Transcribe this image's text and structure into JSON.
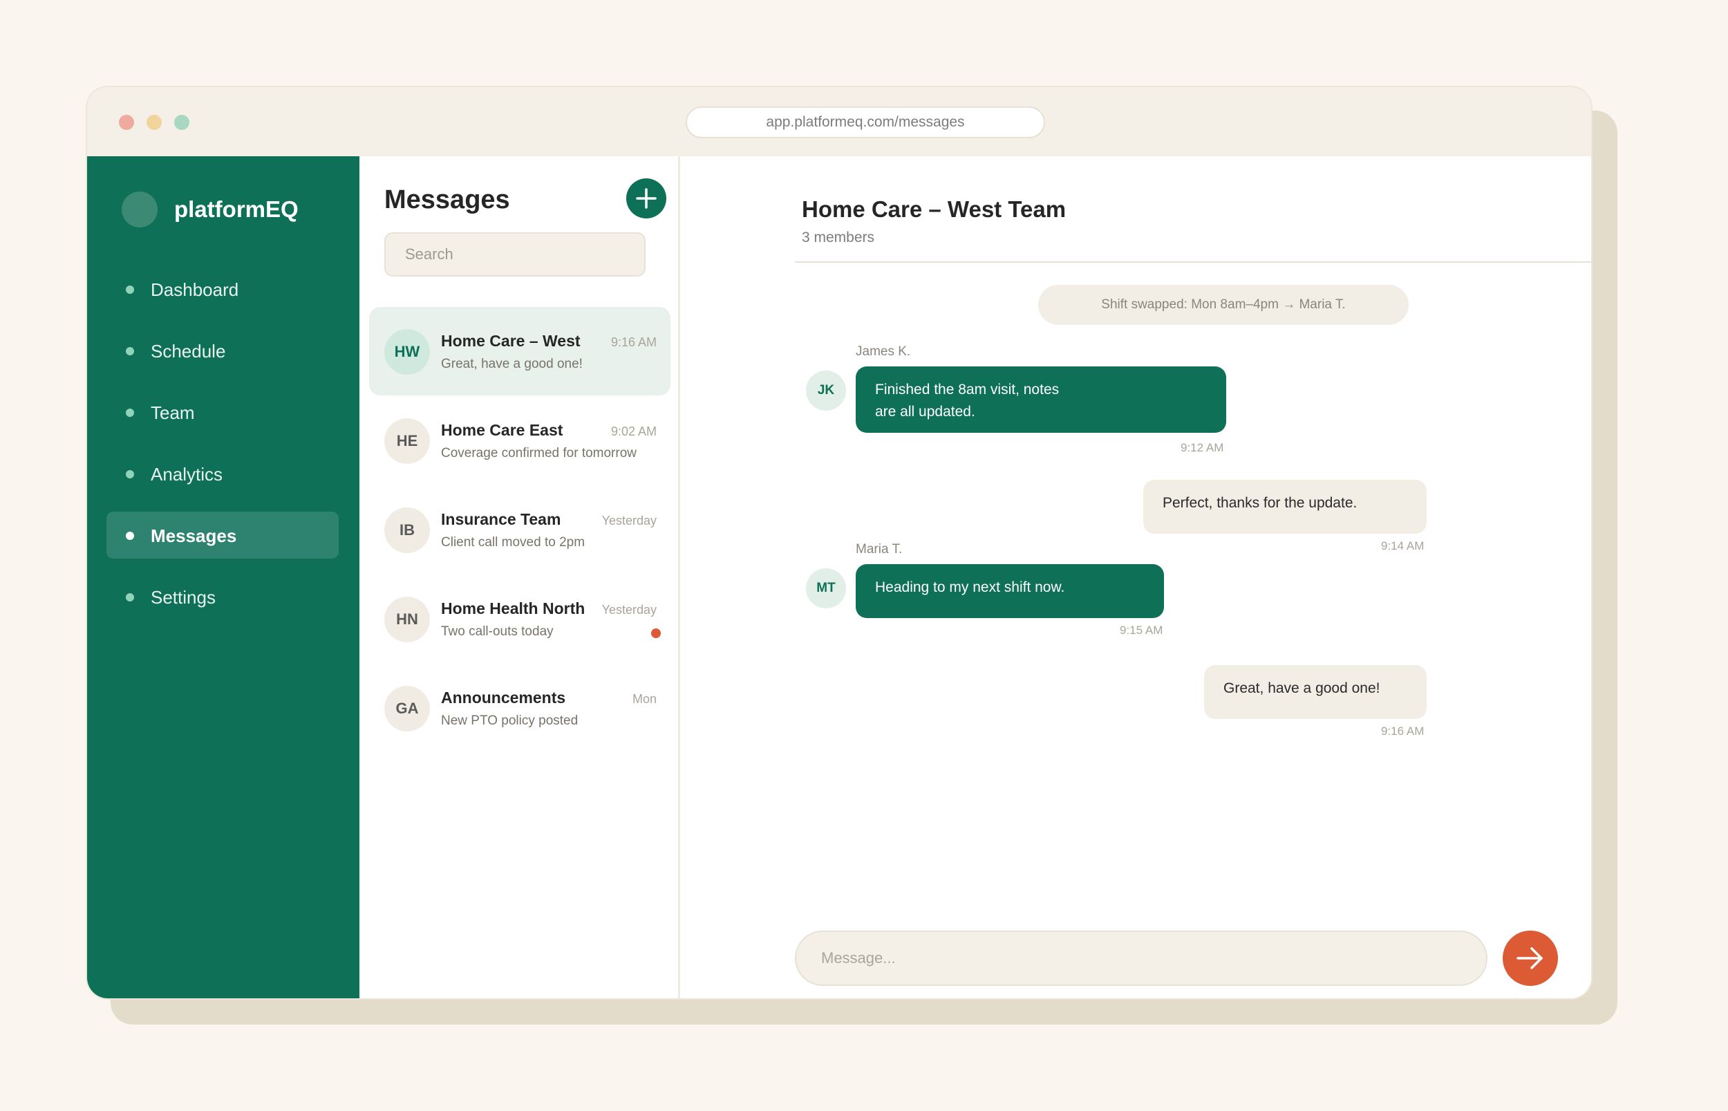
{
  "browser": {
    "url": "app.platformeq.com/messages"
  },
  "sidebar": {
    "brand": "platformEQ",
    "items": [
      {
        "label": "Dashboard"
      },
      {
        "label": "Schedule"
      },
      {
        "label": "Team"
      },
      {
        "label": "Analytics"
      },
      {
        "label": "Messages",
        "active": true
      },
      {
        "label": "Settings"
      }
    ]
  },
  "conversations": {
    "title": "Messages",
    "search_placeholder": "Search",
    "items": [
      {
        "initials": "HW",
        "name": "Home Care – West",
        "time": "9:16 AM",
        "preview": "Great, have a good one!",
        "active": true
      },
      {
        "initials": "HE",
        "name": "Home Care East",
        "time": "9:02 AM",
        "preview": "Coverage confirmed for tomorrow"
      },
      {
        "initials": "IB",
        "name": "Insurance Team",
        "time": "Yesterday",
        "preview": "Client call moved to 2pm"
      },
      {
        "initials": "HN",
        "name": "Home Health North",
        "time": "Yesterday",
        "preview": "Two call-outs today",
        "unread": true
      },
      {
        "initials": "GA",
        "name": "Announcements",
        "time": "Mon",
        "preview": "New PTO policy posted"
      }
    ]
  },
  "chat": {
    "title": "Home Care – West Team",
    "subtitle": "3 members",
    "system_message": "Shift swapped: Mon 8am–4pm → Maria T.",
    "messages": [
      {
        "sender": "James K.",
        "initials": "JK",
        "line1": "Finished the 8am visit, notes",
        "line2": "are all updated.",
        "time": "9:12 AM"
      },
      {
        "text": "Perfect, thanks for the update.",
        "time": "9:14 AM"
      },
      {
        "sender": "Maria T.",
        "initials": "MT",
        "text": "Heading to my next shift now.",
        "time": "9:15 AM"
      },
      {
        "text": "Great, have a good one!",
        "time": "9:16 AM"
      }
    ],
    "composer_placeholder": "Message..."
  },
  "colors": {
    "brand_green": "#0f7058",
    "accent_orange": "#dc5a34",
    "background": "#faf6ef"
  },
  "icons": {
    "new_message": "plus-icon",
    "send": "arrow-right-icon"
  }
}
